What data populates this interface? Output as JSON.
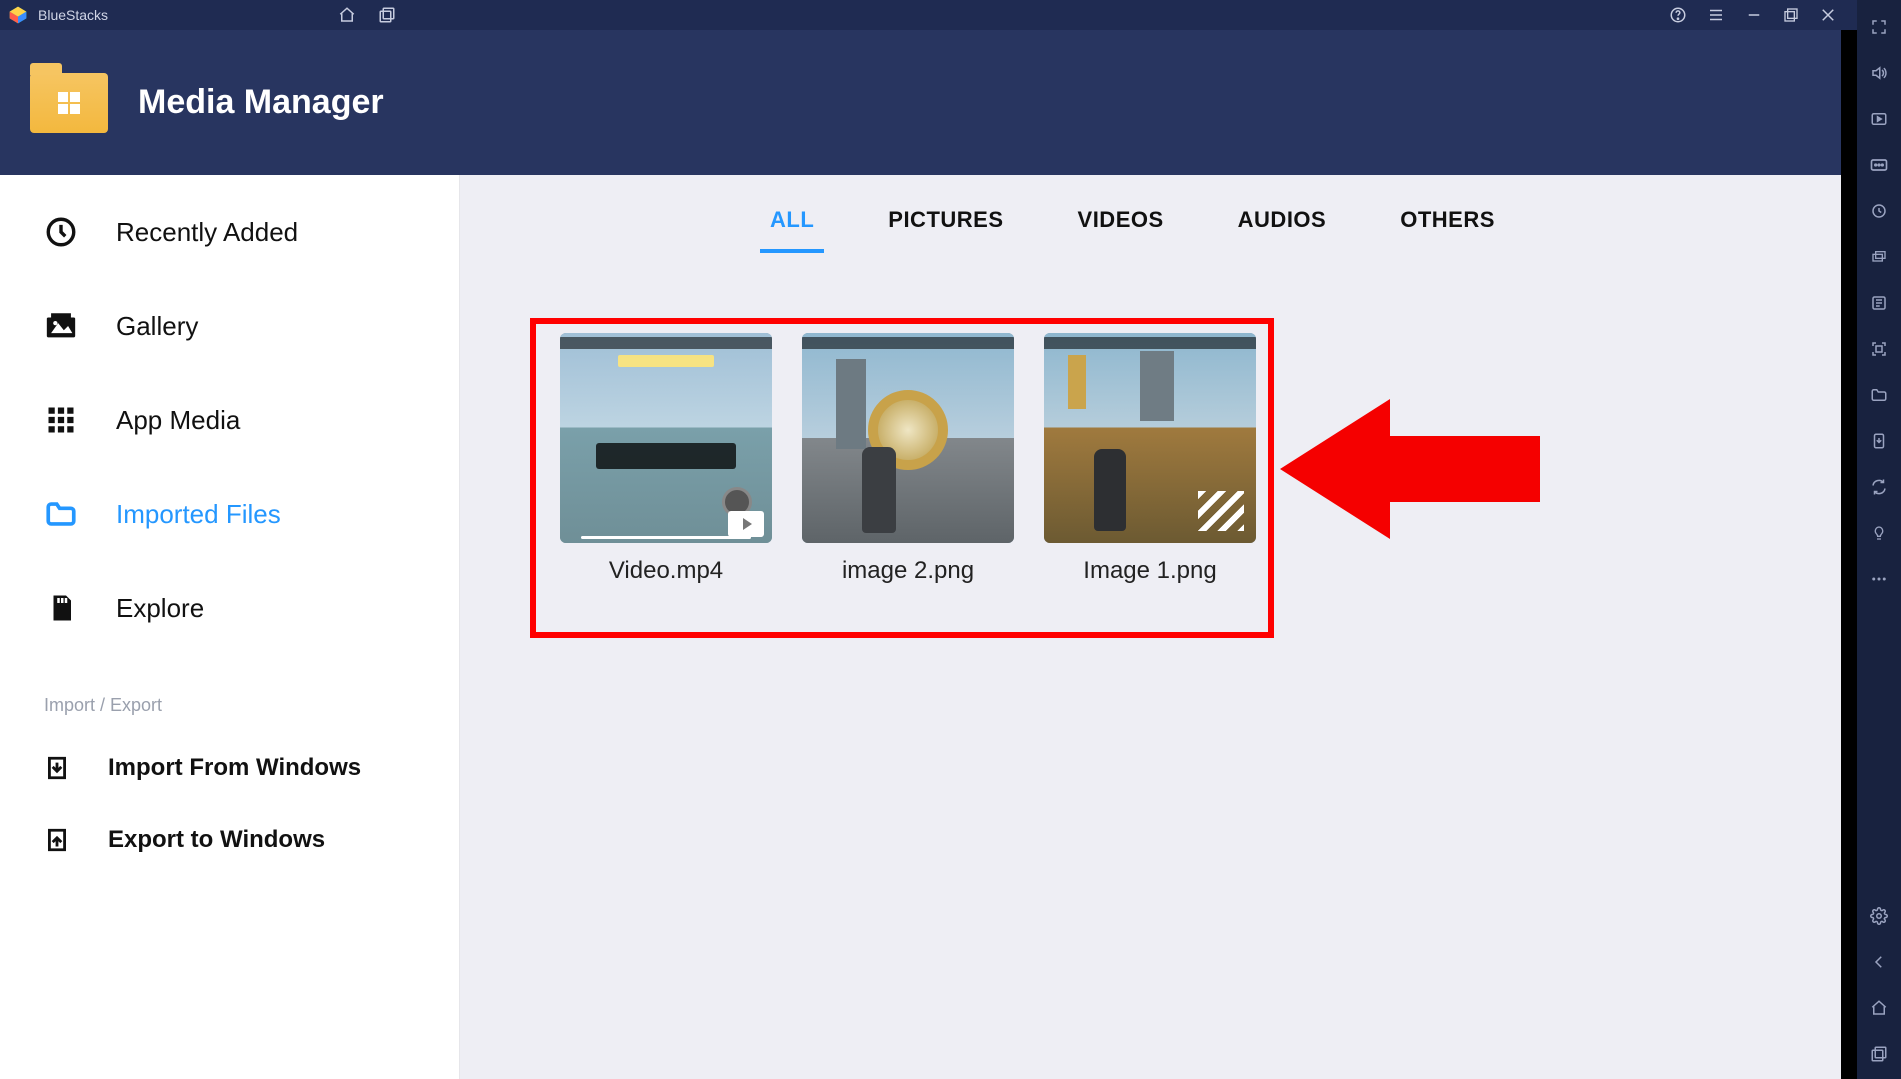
{
  "titlebar": {
    "app_name": "BlueStacks"
  },
  "header": {
    "title": "Media Manager"
  },
  "sidebar": {
    "items": [
      {
        "label": "Recently Added"
      },
      {
        "label": "Gallery"
      },
      {
        "label": "App Media"
      },
      {
        "label": "Imported Files"
      },
      {
        "label": "Explore"
      }
    ],
    "section_label": "Import / Export",
    "actions": [
      {
        "label": "Import From Windows"
      },
      {
        "label": "Export to Windows"
      }
    ]
  },
  "tabs": {
    "items": [
      {
        "label": "ALL",
        "active": true
      },
      {
        "label": "PICTURES"
      },
      {
        "label": "VIDEOS"
      },
      {
        "label": "AUDIOS"
      },
      {
        "label": "OTHERS"
      }
    ]
  },
  "files": [
    {
      "name": "Video.mp4",
      "type": "video"
    },
    {
      "name": "image 2.png",
      "type": "image"
    },
    {
      "name": "Image 1.png",
      "type": "image"
    }
  ]
}
